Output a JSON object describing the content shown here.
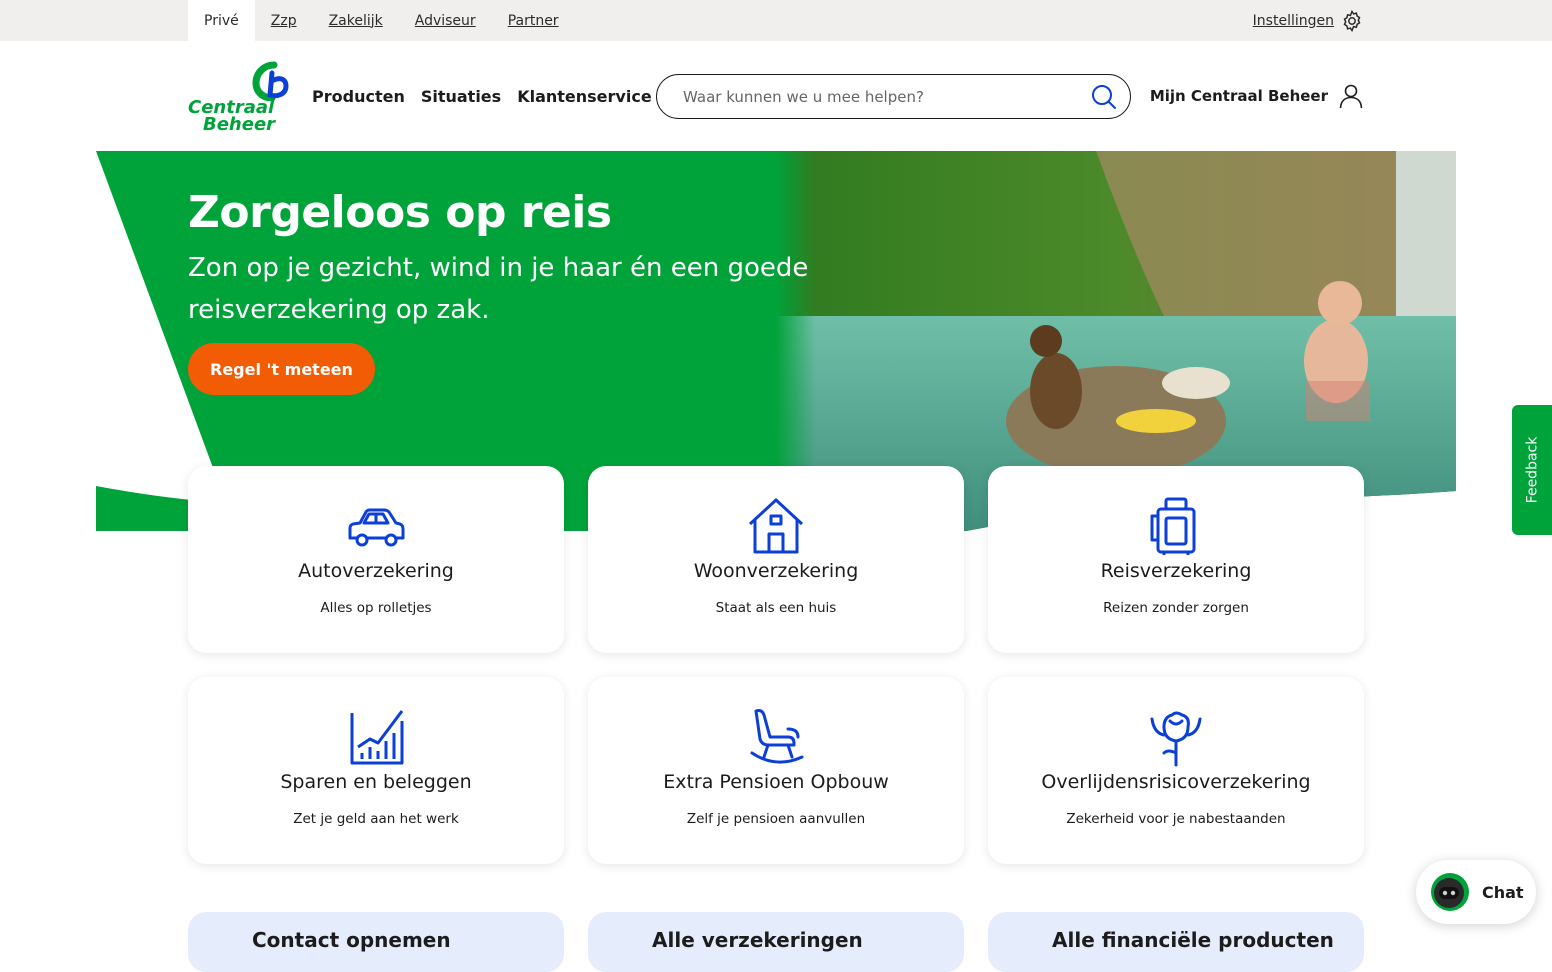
{
  "segments": [
    "Privé",
    "Zzp",
    "Zakelijk",
    "Adviseur",
    "Partner"
  ],
  "settings_label": "Instellingen",
  "logo": {
    "line1": "Centraal",
    "line2": "Beheer"
  },
  "nav": [
    "Producten",
    "Situaties",
    "Klantenservice"
  ],
  "search": {
    "placeholder": "Waar kunnen we u mee helpen?"
  },
  "account_label": "Mijn Centraal Beheer",
  "hero": {
    "title": "Zorgeloos op reis",
    "subtitle": "Zon op je gezicht, wind in je haar én een goede reisverzekering op zak.",
    "cta": "Regel 't meteen"
  },
  "feedback_label": "Feedback",
  "cards": [
    {
      "title": "Autoverzekering",
      "desc": "Alles op rolletjes",
      "icon": "car-icon"
    },
    {
      "title": "Woonverzekering",
      "desc": "Staat als een huis",
      "icon": "house-icon"
    },
    {
      "title": "Reisverzekering",
      "desc": "Reizen zonder zorgen",
      "icon": "suitcase-icon"
    },
    {
      "title": "Sparen en beleggen",
      "desc": "Zet je geld aan het werk",
      "icon": "chart-icon"
    },
    {
      "title": "Extra Pensioen Opbouw",
      "desc": "Zelf je pensioen aanvullen",
      "icon": "rocking-chair-icon"
    },
    {
      "title": "Overlijdensrisicoverzekering",
      "desc": "Zekerheid voor je nabestaanden",
      "icon": "rose-icon"
    }
  ],
  "bottom_cards": [
    "Contact opnemen",
    "Alle verzekeringen",
    "Alle financiële producten"
  ],
  "chat_label": "Chat",
  "colors": {
    "brand_green": "#00a33a",
    "cta_orange": "#f25c05",
    "icon_blue": "#0b3fd8",
    "light_blue": "#e5ecfb"
  }
}
